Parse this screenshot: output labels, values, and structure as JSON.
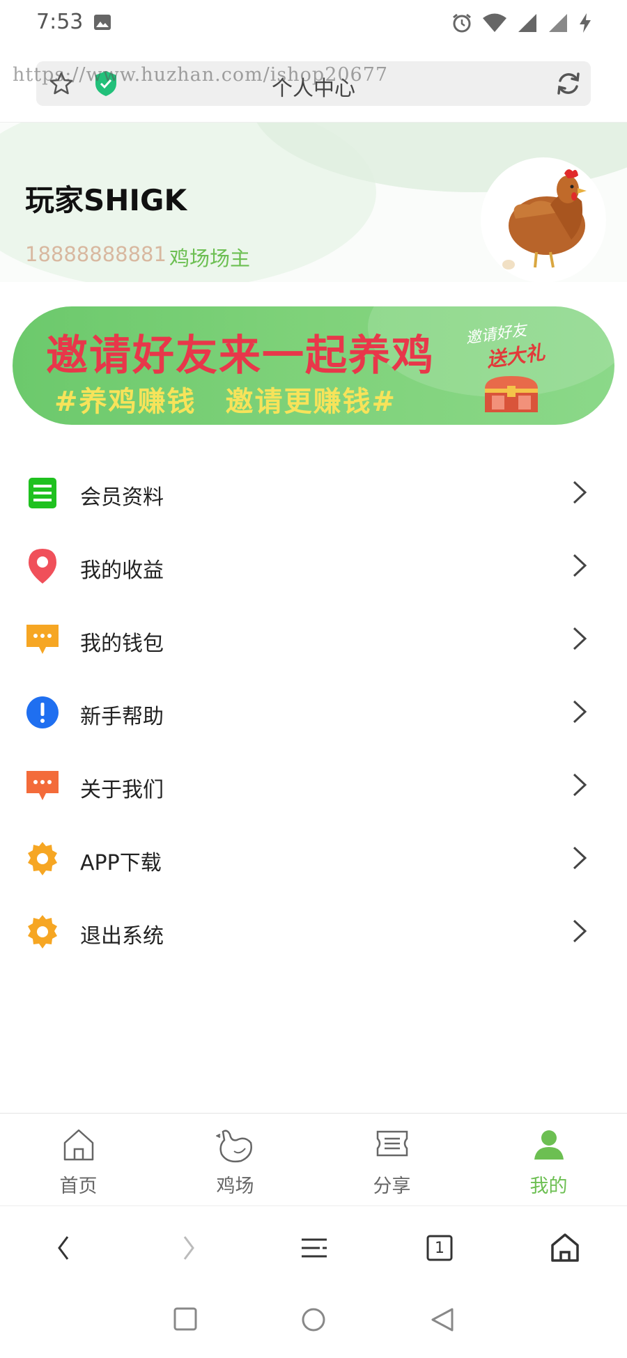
{
  "status_bar": {
    "time": "7:53"
  },
  "browser": {
    "page_title": "个人中心",
    "watermark": "https://www.huzhan.com/ishop20677",
    "tab_count": "1"
  },
  "profile": {
    "name": "玩家SHIGK",
    "phone": "18888888881",
    "role": "鸡场场主"
  },
  "banner": {
    "title": "邀请好友来一起养鸡",
    "subtitle": "#养鸡赚钱　邀请更赚钱#",
    "badge_top": "邀请好友",
    "badge_bottom": "送大礼"
  },
  "menu": [
    {
      "label": "会员资料",
      "icon": "list-icon",
      "color": "#1fc11f"
    },
    {
      "label": "我的收益",
      "icon": "location-pin-icon",
      "color": "#f0505a"
    },
    {
      "label": "我的钱包",
      "icon": "chat-bubble-icon",
      "color": "#f6a623"
    },
    {
      "label": "新手帮助",
      "icon": "info-icon",
      "color": "#1f6ff0"
    },
    {
      "label": "关于我们",
      "icon": "chat-bubble-icon",
      "color": "#f36b3a"
    },
    {
      "label": "APP下载",
      "icon": "gear-icon",
      "color": "#f6a623"
    },
    {
      "label": "退出系统",
      "icon": "gear-icon",
      "color": "#f6a623"
    }
  ],
  "tabs": [
    {
      "label": "首页",
      "icon": "home-icon",
      "active": false
    },
    {
      "label": "鸡场",
      "icon": "chicken-icon",
      "active": false
    },
    {
      "label": "分享",
      "icon": "ticket-icon",
      "active": false
    },
    {
      "label": "我的",
      "icon": "person-icon",
      "active": true
    }
  ],
  "colors": {
    "accent": "#6cbf52",
    "banner_green": "#7fd27a",
    "banner_title": "#e8374a",
    "banner_sub": "#f7e35a"
  }
}
